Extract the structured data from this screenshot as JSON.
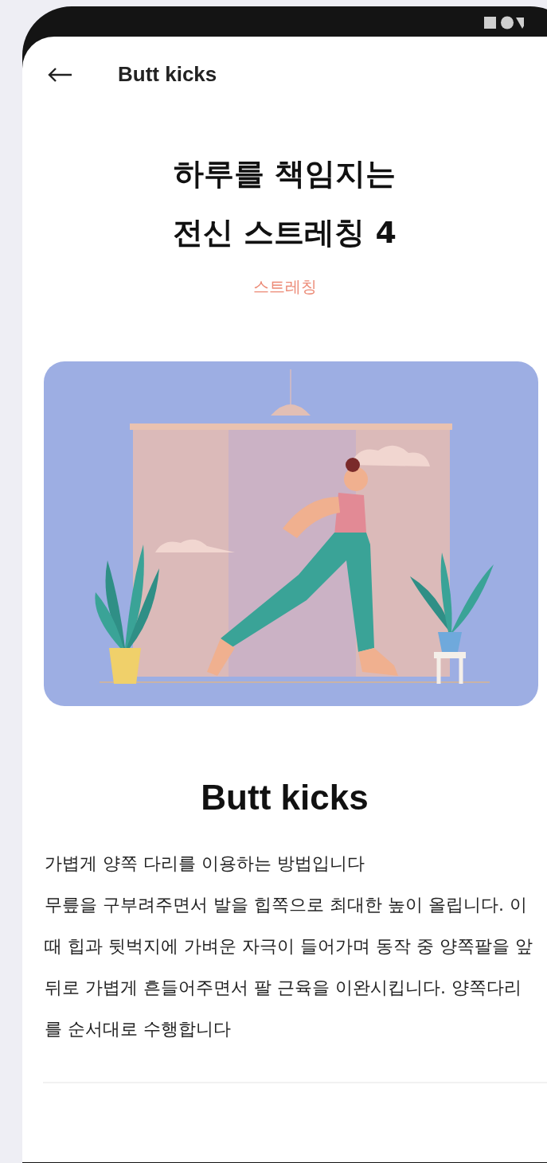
{
  "app_bar": {
    "title": "Butt kicks"
  },
  "routine": {
    "title": "하루를 책임지는\n전신 스트레칭 4",
    "category": "스트레칭"
  },
  "exercise": {
    "name": "Butt kicks",
    "description": "가볍게 양쪽 다리를 이용하는 방법입니다\n무릎을 구부려주면서 발을 힙쪽으로 최대한 높이 올립니다. 이때 힙과 뒷벅지에 가벼운 자극이 들어가며 동작 중 양쪽팔을 앞뒤로 가볍게 흔들어주면서 팔 근육을 이완시킵니다.  양쪽다리를 순서대로 수행합니다"
  }
}
